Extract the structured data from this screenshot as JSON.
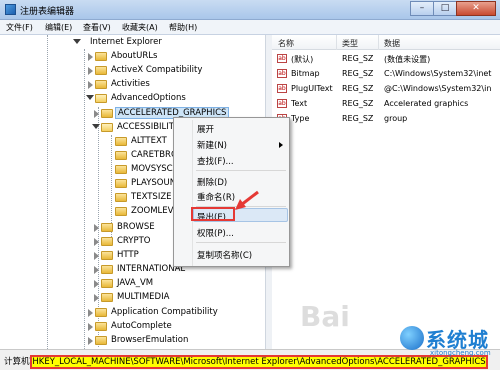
{
  "window": {
    "title": "注册表编辑器",
    "buttons": [
      "–",
      "□",
      "✕"
    ]
  },
  "menubar": {
    "items": [
      "文件(F)",
      "编辑(E)",
      "查看(V)",
      "收藏夹(A)",
      "帮助(H)"
    ]
  },
  "tree": {
    "root": "Internet Explorer",
    "items": [
      {
        "label": "AboutURLs"
      },
      {
        "label": "ActiveX Compatibility"
      },
      {
        "label": "Activities"
      },
      {
        "label": "AdvancedOptions"
      },
      {
        "label": "ACCELERATED_GRAPHICS"
      },
      {
        "label": "ACCESSIBILITY"
      },
      {
        "label": "ALTTEXT"
      },
      {
        "label": "CARETBROWSING"
      },
      {
        "label": "MOVSYSCARET"
      },
      {
        "label": "PLAYSOUNDS"
      },
      {
        "label": "TEXTSIZE"
      },
      {
        "label": "ZOOMLEVEL"
      },
      {
        "label": "BROWSE"
      },
      {
        "label": "CRYPTO"
      },
      {
        "label": "HTTP"
      },
      {
        "label": "INTERNATIONAL"
      },
      {
        "label": "JAVA_VM"
      },
      {
        "label": "MULTIMEDIA"
      },
      {
        "label": "Application Compatibility"
      },
      {
        "label": "AutoComplete"
      },
      {
        "label": "BrowserEmulation"
      }
    ]
  },
  "list": {
    "columns": [
      "名称",
      "类型",
      "数据"
    ],
    "rows": [
      {
        "name": "(默认)",
        "type": "REG_SZ",
        "data": "(数值未设置)"
      },
      {
        "name": "Bitmap",
        "type": "REG_SZ",
        "data": "C:\\Windows\\System32\\inet"
      },
      {
        "name": "PlugUIText",
        "type": "REG_SZ",
        "data": "@C:\\Windows\\System32\\in"
      },
      {
        "name": "Text",
        "type": "REG_SZ",
        "data": "Accelerated graphics"
      },
      {
        "name": "Type",
        "type": "REG_SZ",
        "data": "group"
      }
    ]
  },
  "context_menu": {
    "items": [
      {
        "label": "展开"
      },
      {
        "label": "新建(N)"
      },
      {
        "label": "查找(F)..."
      },
      {
        "label": "删除(D)"
      },
      {
        "label": "重命名(R)"
      },
      {
        "label": "导出(E)"
      },
      {
        "label": "权限(P)..."
      },
      {
        "label": "复制项名称(C)"
      }
    ]
  },
  "statusbar": {
    "prefix": "计算机\\",
    "path": "HKEY_LOCAL_MACHINE\\SOFTWARE\\Microsoft\\Internet Explorer\\AdvancedOptions\\ACCELERATED_GRAPHICS"
  },
  "watermark": {
    "brand": "系统城",
    "url": "xitongcheng.com",
    "logo_text": "Bai"
  },
  "colors": {
    "highlight": "#ffff00",
    "annotation": "#e53935",
    "selection": "#cde4f7"
  }
}
